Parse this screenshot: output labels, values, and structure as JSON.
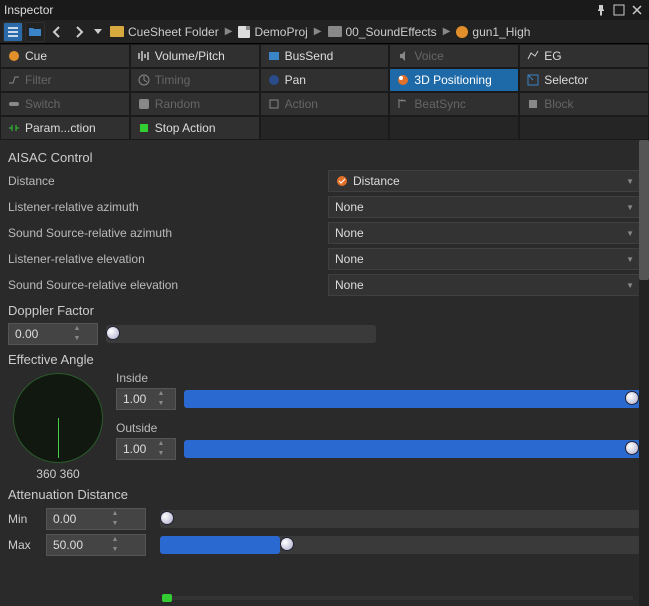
{
  "window": {
    "title": "Inspector"
  },
  "breadcrumb": {
    "folder": "CueSheet Folder",
    "project": "DemoProj",
    "soundfx": "00_SoundEffects",
    "cue": "gun1_High"
  },
  "tabs": [
    {
      "label": "Cue",
      "dark": false,
      "icon": "cue"
    },
    {
      "label": "Volume/Pitch",
      "dark": false,
      "icon": "vp"
    },
    {
      "label": "BusSend",
      "dark": false,
      "icon": "bus"
    },
    {
      "label": "Voice",
      "dark": true,
      "icon": "voice"
    },
    {
      "label": "EG",
      "dark": false,
      "icon": "eg"
    },
    {
      "label": "Filter",
      "dark": true,
      "icon": "filter"
    },
    {
      "label": "Timing",
      "dark": true,
      "icon": "timing"
    },
    {
      "label": "Pan",
      "dark": false,
      "icon": "pan"
    },
    {
      "label": "3D Positioning",
      "dark": false,
      "icon": "3d",
      "selected": true
    },
    {
      "label": "Selector",
      "dark": false,
      "icon": "sel"
    },
    {
      "label": "Switch",
      "dark": true,
      "icon": "switch"
    },
    {
      "label": "Random",
      "dark": true,
      "icon": "random"
    },
    {
      "label": "Action",
      "dark": true,
      "icon": "action"
    },
    {
      "label": "BeatSync",
      "dark": true,
      "icon": "beat"
    },
    {
      "label": "Block",
      "dark": true,
      "icon": "block"
    },
    {
      "label": "Param...ction",
      "dark": false,
      "icon": "param"
    },
    {
      "label": "Stop Action",
      "dark": false,
      "icon": "stop"
    }
  ],
  "aisac": {
    "title": "AISAC Control",
    "rows": [
      {
        "label": "Distance",
        "value": "Distance",
        "icon": true
      },
      {
        "label": "Listener-relative azimuth",
        "value": "None"
      },
      {
        "label": "Sound Source-relative azimuth",
        "value": "None"
      },
      {
        "label": "Listener-relative elevation",
        "value": "None"
      },
      {
        "label": "Sound Source-relative elevation",
        "value": "None"
      }
    ]
  },
  "doppler": {
    "title": "Doppler Factor",
    "value": "0.00",
    "fill": 0
  },
  "effective": {
    "title": "Effective Angle",
    "angle_text": "360 360",
    "inside": {
      "label": "Inside",
      "value": "1.00",
      "fill": 100
    },
    "outside": {
      "label": "Outside",
      "value": "1.00",
      "fill": 100
    }
  },
  "attenuation": {
    "title": "Attenuation Distance",
    "min": {
      "label": "Min",
      "value": "0.00",
      "fill": 0
    },
    "max": {
      "label": "Max",
      "value": "50.00",
      "fill": 25
    }
  }
}
